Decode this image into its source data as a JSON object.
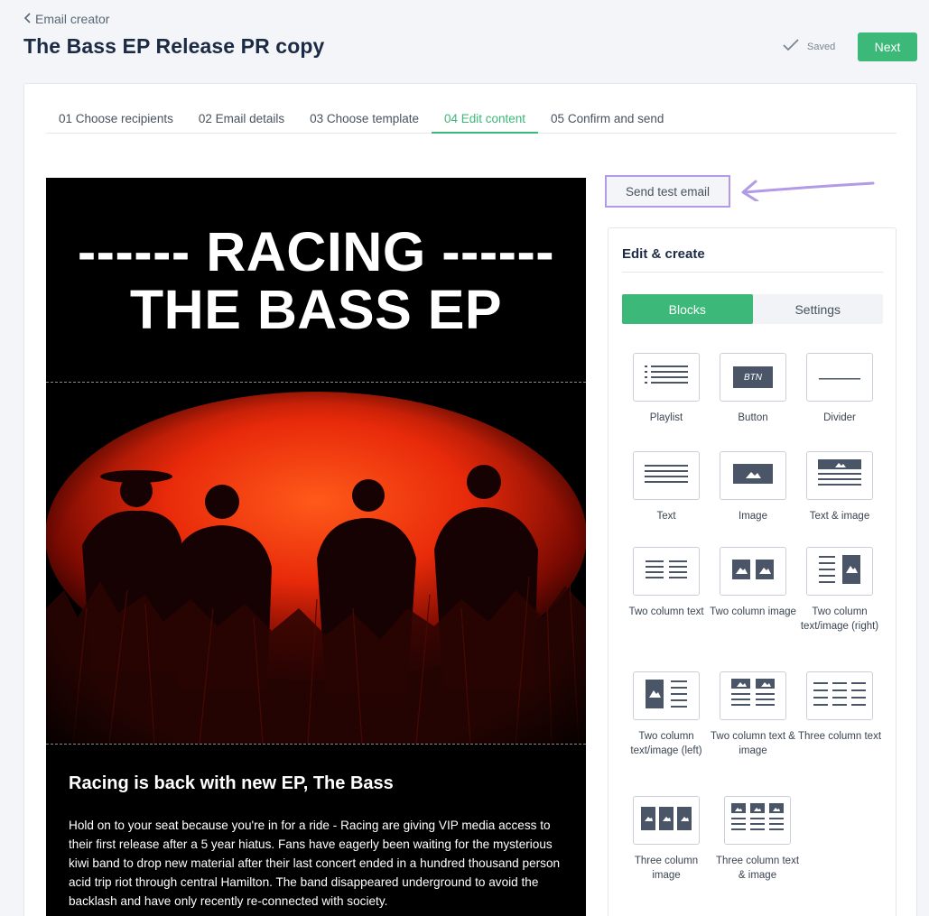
{
  "header": {
    "back_label": "Email creator",
    "title": "The Bass EP Release PR copy",
    "saved_label": "Saved",
    "next_label": "Next"
  },
  "steps": [
    {
      "label": "01 Choose recipients",
      "active": false
    },
    {
      "label": "02 Email details",
      "active": false
    },
    {
      "label": "03 Choose template",
      "active": false
    },
    {
      "label": "04 Edit content",
      "active": true
    },
    {
      "label": "05 Confirm and send",
      "active": false
    }
  ],
  "email": {
    "hero_line1": "------ RACING ------",
    "hero_line2": "THE BASS EP",
    "heading": "Racing is back with new EP, The Bass",
    "paragraph": "Hold on to your seat because you're in for a ride - Racing are giving VIP media access to their first release after a 5 year hiatus. Fans have eagerly been waiting for the mysterious kiwi band to drop new material after their last concert ended in a hundred thousand person acid trip riot through central Hamilton. The band disappeared underground to avoid the backlash and have only recently re-connected with society."
  },
  "send_test_label": "Send test email",
  "panel": {
    "title": "Edit & create",
    "tabs": [
      "Blocks",
      "Settings"
    ],
    "active_tab": "Blocks",
    "blocks": [
      {
        "label": "Playlist",
        "icon": "playlist-icon"
      },
      {
        "label": "Button",
        "icon": "button-icon",
        "icon_text": "BTN"
      },
      {
        "label": "Divider",
        "icon": "divider-icon"
      },
      {
        "label": "Text",
        "icon": "text-icon"
      },
      {
        "label": "Image",
        "icon": "image-icon"
      },
      {
        "label": "Text & image",
        "icon": "text-image-icon"
      },
      {
        "label": "Two column text",
        "icon": "two-column-text-icon"
      },
      {
        "label": "Two column image",
        "icon": "two-column-image-icon"
      },
      {
        "label": "Two column text/image (right)",
        "icon": "two-column-text-image-right-icon"
      },
      {
        "label": "Two column text/image (left)",
        "icon": "two-column-text-image-left-icon"
      },
      {
        "label": "Two column text & image",
        "icon": "two-column-text-and-image-icon"
      },
      {
        "label": "Three column text",
        "icon": "three-column-text-icon"
      },
      {
        "label": "Three column image",
        "icon": "three-column-image-icon"
      },
      {
        "label": "Three column text & image",
        "icon": "three-column-text-and-image-icon"
      }
    ]
  },
  "colors": {
    "accent": "#3cb878",
    "highlight": "#b39ae6",
    "icon": "#4a5568"
  }
}
